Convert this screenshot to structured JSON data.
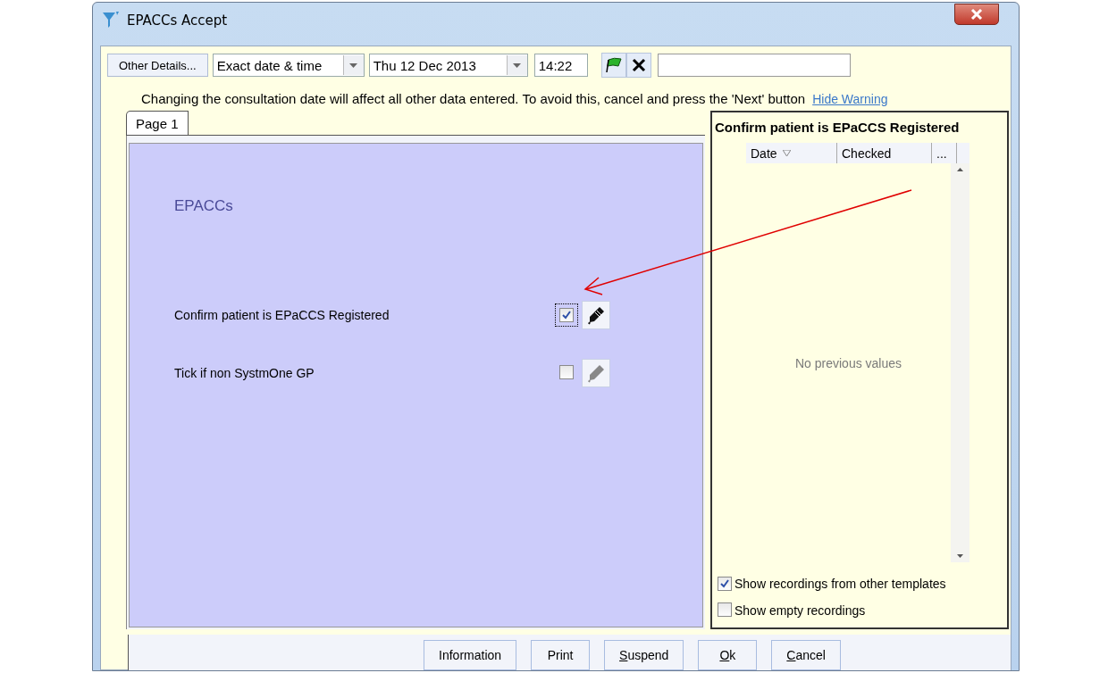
{
  "window": {
    "title": "EPACCs Accept"
  },
  "toolbar": {
    "details_button": "Other Details...",
    "date_mode": "Exact date & time",
    "date": "Thu 12 Dec 2013",
    "time": "14:22"
  },
  "warning": {
    "text": "Changing the consultation date will affect all other data entered. To avoid this, cancel and press the 'Next' button",
    "link": "Hide Warning"
  },
  "tabs": [
    {
      "label": "Page 1",
      "selected": true
    }
  ],
  "page": {
    "heading": "EPACCs",
    "items": [
      {
        "label": "Confirm patient is EPaCCS Registered",
        "checked": true,
        "focused": true,
        "enabled": true
      },
      {
        "label": "Tick if non SystmOne GP",
        "checked": false,
        "focused": false,
        "enabled": false
      }
    ]
  },
  "history": {
    "title": "Confirm patient is EPaCCS Registered",
    "columns": [
      {
        "label": "Date",
        "sorted": true
      },
      {
        "label": "Checked",
        "sorted": false
      },
      {
        "label": "...",
        "sorted": false
      }
    ],
    "empty_text": "No previous values",
    "options": [
      {
        "label": "Show recordings from other templates",
        "checked": true
      },
      {
        "label": "Show empty recordings",
        "checked": false
      }
    ]
  },
  "buttons": [
    {
      "label": "Information",
      "underline_first": false
    },
    {
      "label": "Print",
      "underline_first": false
    },
    {
      "label": "Suspend",
      "underline_first": true
    },
    {
      "label": "Ok",
      "underline_first": true
    },
    {
      "label": "Cancel",
      "underline_first": true
    }
  ]
}
